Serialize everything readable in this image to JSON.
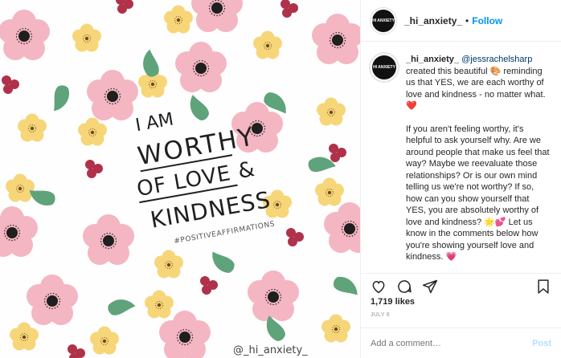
{
  "post": {
    "image_text": {
      "line1": "I AM",
      "line2": "WORTHY",
      "line3": "OF LOVE &",
      "line4": "KINDNESS",
      "hashtag": "#POSITIVEAFFIRMATIONS",
      "handle": "@_hi_anxiety_"
    },
    "colors": {
      "pink": "#f4b6c2",
      "yellow": "#f7d67a",
      "green": "#5fa37b",
      "red_berry": "#b0314a",
      "accent_link": "#0095f6",
      "mention": "#00376b"
    }
  },
  "header": {
    "avatar_text": "HI ANXIETY",
    "username": "_hi_anxiety_",
    "separator": "•",
    "follow_label": "Follow"
  },
  "caption": {
    "username": "_hi_anxiety_",
    "mention": "@jessrachelsharp",
    "p1_rest": " created this beautiful 🎨 reminding us that YES, we are each worthy of love and kindness - no matter what. ❤️",
    "p2": "If you aren't feeling worthy, it's helpful to ask yourself why. Are we around people that make us feel that way? Maybe we reevaluate those relationships? Or is our own mind telling us we're not worthy? If so, how can you show yourself that YES, you are absolutely worthy of love and kindness? 🌟💕 Let us know in the comments below how you're showing yourself love and kindness. 💗",
    "dots": [
      ".",
      ".",
      ".",
      ".",
      "."
    ]
  },
  "actions": {
    "like_icon": "heart-icon",
    "comment_icon": "comment-icon",
    "share_icon": "share-icon",
    "save_icon": "bookmark-icon"
  },
  "likes_text": "1,719 likes",
  "date_text": "JULY 6",
  "comment_box": {
    "placeholder": "Add a comment…",
    "post_label": "Post"
  }
}
